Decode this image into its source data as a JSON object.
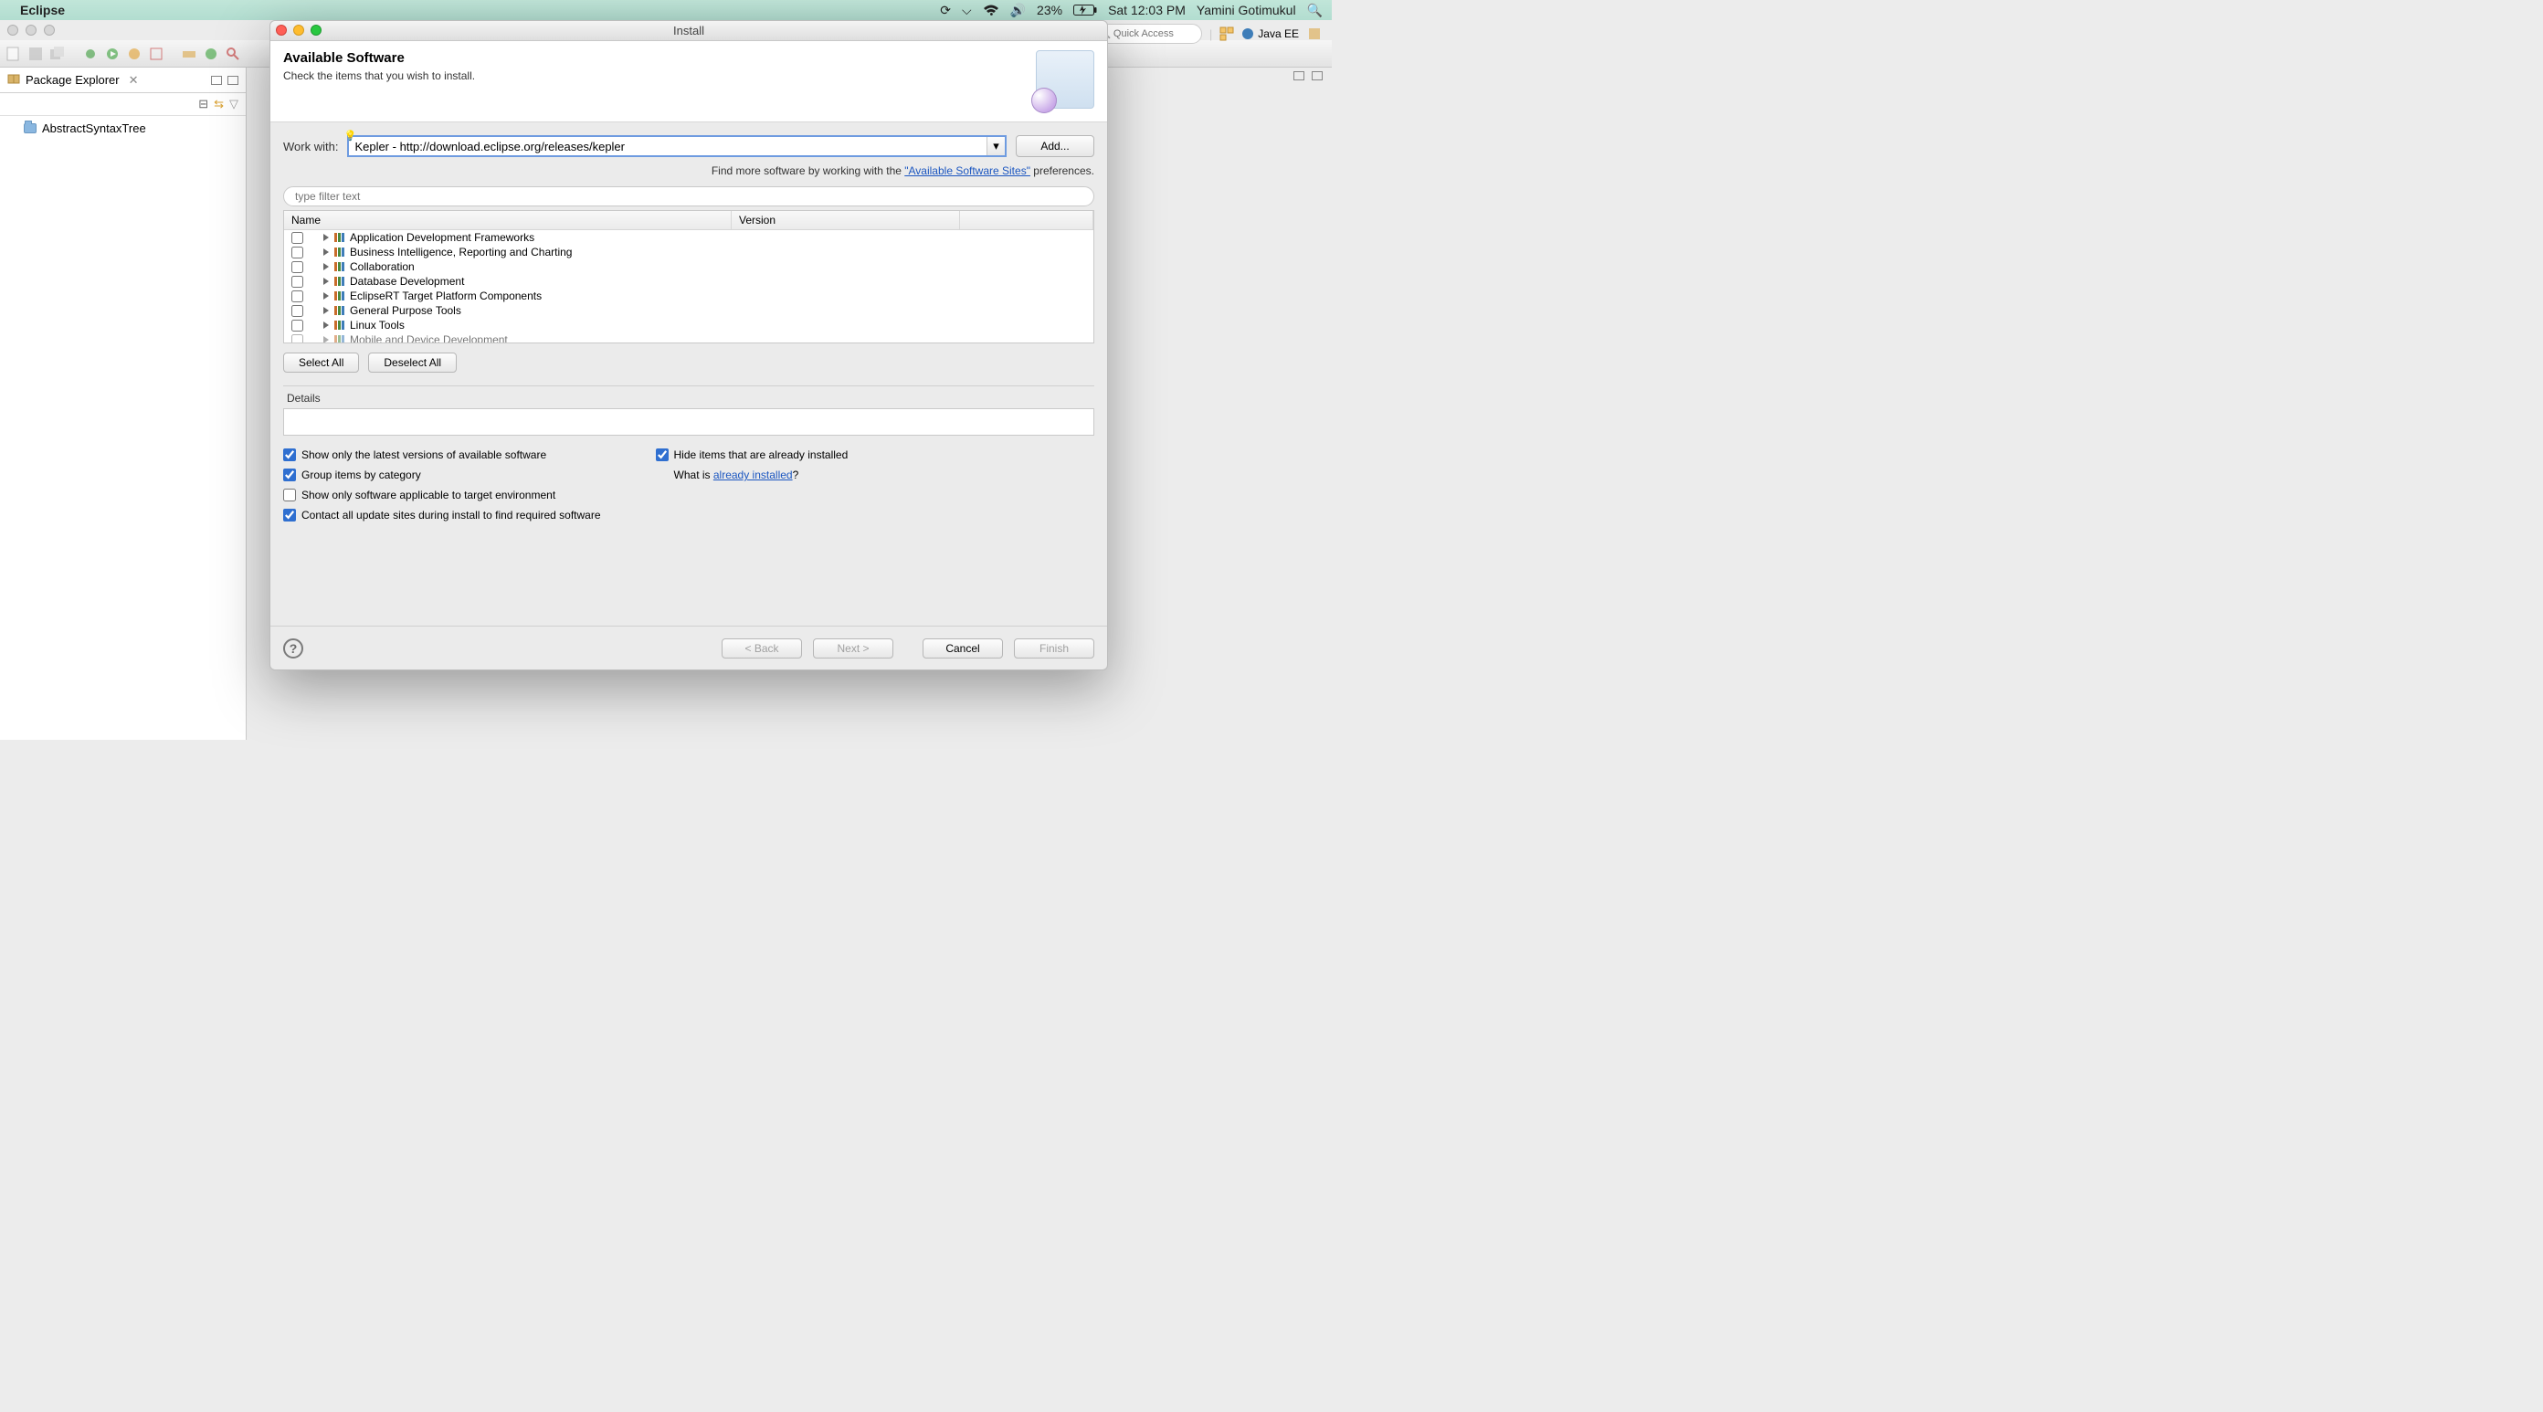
{
  "menubar": {
    "app": "Eclipse",
    "battery": "23%",
    "clock": "Sat 12:03 PM",
    "user": "Yamini Gotimukul"
  },
  "eclipse": {
    "quick_access_placeholder": "Quick Access",
    "perspective_java_ee": "Java EE",
    "package_explorer_title": "Package Explorer",
    "tree_project": "AbstractSyntaxTree"
  },
  "install": {
    "window_title": "Install",
    "header_title": "Available Software",
    "header_subtitle": "Check the items that you wish to install.",
    "work_with_label": "Work with:",
    "work_with_value": "Kepler - http://download.eclipse.org/releases/kepler",
    "add_btn": "Add...",
    "findmore_pre": "Find more software by working with the ",
    "findmore_link": "\"Available Software Sites\"",
    "findmore_post": " preferences.",
    "filter_placeholder": "type filter text",
    "col_name": "Name",
    "col_version": "Version",
    "categories": [
      "Application Development Frameworks",
      "Business Intelligence, Reporting and Charting",
      "Collaboration",
      "Database Development",
      "EclipseRT Target Platform Components",
      "General Purpose Tools",
      "Linux Tools",
      "Mobile and Device Development"
    ],
    "select_all": "Select All",
    "deselect_all": "Deselect All",
    "details_label": "Details",
    "opt_latest": "Show only the latest versions of available software",
    "opt_group": "Group items by category",
    "opt_target": "Show only software applicable to target environment",
    "opt_contact": "Contact all update sites during install to find required software",
    "opt_hide": "Hide items that are already installed",
    "what_is_pre": "What is ",
    "what_is_link": "already installed",
    "what_is_post": "?",
    "btn_back": "< Back",
    "btn_next": "Next >",
    "btn_cancel": "Cancel",
    "btn_finish": "Finish"
  }
}
